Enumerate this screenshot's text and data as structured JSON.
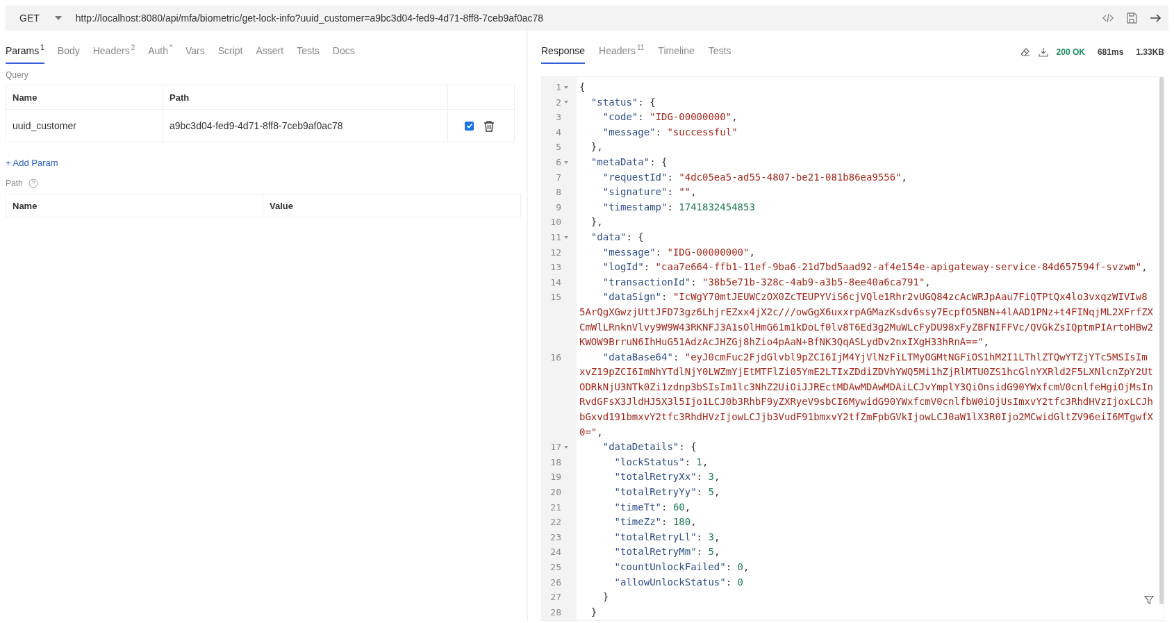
{
  "request": {
    "method": "GET",
    "url": "http://localhost:8080/api/mfa/biometric/get-lock-info?uuid_customer=a9bc3d04-fed9-4d71-8ff8-7ceb9af0ac78"
  },
  "request_tabs": [
    {
      "label": "Params",
      "badge": "1",
      "selected": true
    },
    {
      "label": "Body",
      "selected": false
    },
    {
      "label": "Headers",
      "badge": "2",
      "selected": false
    },
    {
      "label": "Auth",
      "badge": "*",
      "selected": false
    },
    {
      "label": "Vars",
      "selected": false
    },
    {
      "label": "Script",
      "selected": false
    },
    {
      "label": "Assert",
      "selected": false
    },
    {
      "label": "Tests",
      "selected": false
    },
    {
      "label": "Docs",
      "selected": false
    }
  ],
  "query": {
    "label": "Query",
    "columns": [
      "Name",
      "Path"
    ],
    "rows": [
      {
        "name": "uuid_customer",
        "value": "a9bc3d04-fed9-4d71-8ff8-7ceb9af0ac78",
        "enabled": true
      }
    ],
    "add_label": "+ Add Param"
  },
  "path": {
    "label": "Path",
    "columns": [
      "Name",
      "Value"
    ]
  },
  "response_tabs": [
    {
      "label": "Response",
      "selected": true
    },
    {
      "label": "Headers",
      "badge": "11",
      "selected": false
    },
    {
      "label": "Timeline",
      "selected": false
    },
    {
      "label": "Tests",
      "selected": false
    }
  ],
  "response_meta": {
    "status": "200 OK",
    "time": "681ms",
    "size": "1.33KB"
  },
  "code_lines": [
    {
      "number": "1",
      "foldable": true,
      "tokens": [
        {
          "kind": "punct",
          "text": "{"
        }
      ]
    },
    {
      "number": "2",
      "foldable": true,
      "tokens": [
        {
          "kind": "key",
          "text": "  \"status\""
        },
        {
          "kind": "punct",
          "text": ": {"
        }
      ]
    },
    {
      "number": "3",
      "foldable": false,
      "tokens": [
        {
          "kind": "key",
          "text": "    \"code\""
        },
        {
          "kind": "punct",
          "text": ": "
        },
        {
          "kind": "string",
          "text": "\"IDG-00000000\""
        },
        {
          "kind": "punct",
          "text": ","
        }
      ]
    },
    {
      "number": "4",
      "foldable": false,
      "tokens": [
        {
          "kind": "key",
          "text": "    \"message\""
        },
        {
          "kind": "punct",
          "text": ": "
        },
        {
          "kind": "string",
          "text": "\"successful\""
        }
      ]
    },
    {
      "number": "5",
      "foldable": false,
      "tokens": [
        {
          "kind": "punct",
          "text": "  },"
        }
      ]
    },
    {
      "number": "6",
      "foldable": true,
      "tokens": [
        {
          "kind": "key",
          "text": "  \"metaData\""
        },
        {
          "kind": "punct",
          "text": ": {"
        }
      ]
    },
    {
      "number": "7",
      "foldable": false,
      "tokens": [
        {
          "kind": "key",
          "text": "    \"requestId\""
        },
        {
          "kind": "punct",
          "text": ": "
        },
        {
          "kind": "string",
          "text": "\"4dc05ea5-ad55-4807-be21-081b86ea9556\""
        },
        {
          "kind": "punct",
          "text": ","
        }
      ]
    },
    {
      "number": "8",
      "foldable": false,
      "tokens": [
        {
          "kind": "key",
          "text": "    \"signature\""
        },
        {
          "kind": "punct",
          "text": ": "
        },
        {
          "kind": "string",
          "text": "\"\""
        },
        {
          "kind": "punct",
          "text": ","
        }
      ]
    },
    {
      "number": "9",
      "foldable": false,
      "tokens": [
        {
          "kind": "key",
          "text": "    \"timestamp\""
        },
        {
          "kind": "punct",
          "text": ": "
        },
        {
          "kind": "number",
          "text": "1741832454853"
        }
      ]
    },
    {
      "number": "10",
      "foldable": false,
      "tokens": [
        {
          "kind": "punct",
          "text": "  },"
        }
      ]
    },
    {
      "number": "11",
      "foldable": true,
      "tokens": [
        {
          "kind": "key",
          "text": "  \"data\""
        },
        {
          "kind": "punct",
          "text": ": {"
        }
      ]
    },
    {
      "number": "12",
      "foldable": false,
      "tokens": [
        {
          "kind": "key",
          "text": "    \"message\""
        },
        {
          "kind": "punct",
          "text": ": "
        },
        {
          "kind": "string",
          "text": "\"IDG-00000000\""
        },
        {
          "kind": "punct",
          "text": ","
        }
      ]
    },
    {
      "number": "13",
      "foldable": false,
      "tokens": [
        {
          "kind": "key",
          "text": "    \"logId\""
        },
        {
          "kind": "punct",
          "text": ": "
        },
        {
          "kind": "string",
          "text": "\"caa7e664-ffb1-11ef-9ba6-21d7bd5aad92-af4e154e-apigateway-service-84d657594f-svzwm\""
        },
        {
          "kind": "punct",
          "text": ","
        }
      ]
    },
    {
      "number": "14",
      "foldable": false,
      "tokens": [
        {
          "kind": "key",
          "text": "    \"transactionId\""
        },
        {
          "kind": "punct",
          "text": ": "
        },
        {
          "kind": "string",
          "text": "\"38b5e71b-328c-4ab9-a3b5-8ee40a6ca791\""
        },
        {
          "kind": "punct",
          "text": ","
        }
      ]
    },
    {
      "number": "15",
      "foldable": false,
      "tokens": [
        {
          "kind": "key",
          "text": "    \"dataSign\""
        },
        {
          "kind": "punct",
          "text": ": "
        },
        {
          "kind": "string",
          "text": "\"IcWgY70mtJEUWCzOX0ZcTEUPYViS6cjVQle1Rhr2vUGQ84zcAcWRJpAau7FiQTPtQx4lo3vxqzWIVIw85ArQgXGwzjUttJFD73gz6LhjrEZxx4jX2c///owGgX6uxxrpAGMazKsdv6ssy7EcpfO5NBN+4lAAD1PNz+t4FINqjML2XFrfZXCmWlLRnknVlvy9W9W43RKNFJ3A1sOlHmG61m1kDoLf0lv8T6Ed3g2MuWLcFyDU98xFyZBFNIFFVc/QVGkZsIQptmPIArtoHBw2KWOW9BrruN6IhHuG51AdzAcJHZGj8hZio4pAaN+BfNK3QqASLydDv2nxIXgH33hRnA==\""
        },
        {
          "kind": "punct",
          "text": ","
        }
      ]
    },
    {
      "number": "16",
      "foldable": false,
      "tokens": [
        {
          "kind": "key",
          "text": "    \"dataBase64\""
        },
        {
          "kind": "punct",
          "text": ": "
        },
        {
          "kind": "string",
          "text": "\"eyJ0cmFuc2FjdGlvbl9pZCI6IjM4YjVlNzFiLTMyOGMtNGFiOS1hM2I1LThlZTQwYTZjYTc5MSIsImxvZ19pZCI6ImNhYTdlNjY0LWZmYjEtMTFlZi05YmE2LTIxZDdiZDVhYWQ5Mi1hZjRlMTU0ZS1hcGlnYXRld2F5LXNlcnZpY2UtODRkNjU3NTk0Zi1zdnp3bSIsIm1lc3NhZ2UiOiJJREctMDAwMDAwMDAiLCJvYmplY3QiOnsidG90YWxfcmV0cnlfeHgiOjMsInRvdGFsX3JldHJ5X3l5Ijo1LCJ0b3RhbF9yZXRyeV9sbCI6MywidG90YWxfcmV0cnlfbW0iOjUsImxvY2tfc3RhdHVzIjoxLCJhbGxvd191bmxvY2tfc3RhdHVzIjowLCJjb3VudF91bmxvY2tfZmFpbGVkIjowLCJ0aW1lX3R0Ijo2MCwidGltZV96eiI6MTgwfX0=\""
        },
        {
          "kind": "punct",
          "text": ","
        }
      ]
    },
    {
      "number": "17",
      "foldable": true,
      "tokens": [
        {
          "kind": "key",
          "text": "    \"dataDetails\""
        },
        {
          "kind": "punct",
          "text": ": {"
        }
      ]
    },
    {
      "number": "18",
      "foldable": false,
      "tokens": [
        {
          "kind": "key",
          "text": "      \"lockStatus\""
        },
        {
          "kind": "punct",
          "text": ": "
        },
        {
          "kind": "number",
          "text": "1"
        },
        {
          "kind": "punct",
          "text": ","
        }
      ]
    },
    {
      "number": "19",
      "foldable": false,
      "tokens": [
        {
          "kind": "key",
          "text": "      \"totalRetryXx\""
        },
        {
          "kind": "punct",
          "text": ": "
        },
        {
          "kind": "number",
          "text": "3"
        },
        {
          "kind": "punct",
          "text": ","
        }
      ]
    },
    {
      "number": "20",
      "foldable": false,
      "tokens": [
        {
          "kind": "key",
          "text": "      \"totalRetryYy\""
        },
        {
          "kind": "punct",
          "text": ": "
        },
        {
          "kind": "number",
          "text": "5"
        },
        {
          "kind": "punct",
          "text": ","
        }
      ]
    },
    {
      "number": "21",
      "foldable": false,
      "tokens": [
        {
          "kind": "key",
          "text": "      \"timeTt\""
        },
        {
          "kind": "punct",
          "text": ": "
        },
        {
          "kind": "number",
          "text": "60"
        },
        {
          "kind": "punct",
          "text": ","
        }
      ]
    },
    {
      "number": "22",
      "foldable": false,
      "tokens": [
        {
          "kind": "key",
          "text": "      \"timeZz\""
        },
        {
          "kind": "punct",
          "text": ": "
        },
        {
          "kind": "number",
          "text": "180"
        },
        {
          "kind": "punct",
          "text": ","
        }
      ]
    },
    {
      "number": "23",
      "foldable": false,
      "tokens": [
        {
          "kind": "key",
          "text": "      \"totalRetryLl\""
        },
        {
          "kind": "punct",
          "text": ": "
        },
        {
          "kind": "number",
          "text": "3"
        },
        {
          "kind": "punct",
          "text": ","
        }
      ]
    },
    {
      "number": "24",
      "foldable": false,
      "tokens": [
        {
          "kind": "key",
          "text": "      \"totalRetryMm\""
        },
        {
          "kind": "punct",
          "text": ": "
        },
        {
          "kind": "number",
          "text": "5"
        },
        {
          "kind": "punct",
          "text": ","
        }
      ]
    },
    {
      "number": "25",
      "foldable": false,
      "tokens": [
        {
          "kind": "key",
          "text": "      \"countUnlockFailed\""
        },
        {
          "kind": "punct",
          "text": ": "
        },
        {
          "kind": "number",
          "text": "0"
        },
        {
          "kind": "punct",
          "text": ","
        }
      ]
    },
    {
      "number": "26",
      "foldable": false,
      "tokens": [
        {
          "kind": "key",
          "text": "      \"allowUnlockStatus\""
        },
        {
          "kind": "punct",
          "text": ": "
        },
        {
          "kind": "number",
          "text": "0"
        }
      ]
    },
    {
      "number": "27",
      "foldable": false,
      "tokens": [
        {
          "kind": "punct",
          "text": "    }"
        }
      ]
    },
    {
      "number": "28",
      "foldable": false,
      "tokens": [
        {
          "kind": "punct",
          "text": "  }"
        }
      ]
    }
  ]
}
